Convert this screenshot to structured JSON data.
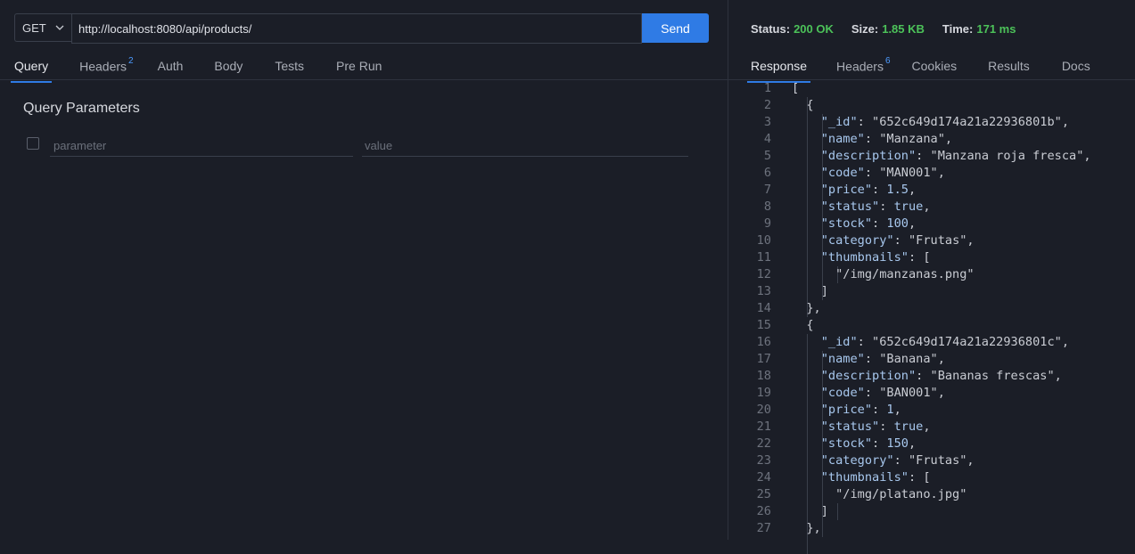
{
  "request": {
    "method": "GET",
    "url": "http://localhost:8080/api/products/",
    "send_label": "Send"
  },
  "request_tabs": [
    {
      "label": "Query",
      "badge": ""
    },
    {
      "label": "Headers",
      "badge": "2"
    },
    {
      "label": "Auth",
      "badge": ""
    },
    {
      "label": "Body",
      "badge": ""
    },
    {
      "label": "Tests",
      "badge": ""
    },
    {
      "label": "Pre Run",
      "badge": ""
    }
  ],
  "query": {
    "title": "Query Parameters",
    "param_placeholder": "parameter",
    "value_placeholder": "value"
  },
  "status": {
    "status_label": "Status:",
    "status_value": "200 OK",
    "size_label": "Size:",
    "size_value": "1.85 KB",
    "time_label": "Time:",
    "time_value": "171 ms"
  },
  "response_tabs": [
    {
      "label": "Response",
      "badge": ""
    },
    {
      "label": "Headers",
      "badge": "6"
    },
    {
      "label": "Cookies",
      "badge": ""
    },
    {
      "label": "Results",
      "badge": ""
    },
    {
      "label": "Docs",
      "badge": ""
    }
  ],
  "response_lines": [
    {
      "n": "1",
      "t": "["
    },
    {
      "n": "2",
      "t": "  {"
    },
    {
      "n": "3",
      "t": "    \"_id\": \"652c649d174a21a22936801b\","
    },
    {
      "n": "4",
      "t": "    \"name\": \"Manzana\","
    },
    {
      "n": "5",
      "t": "    \"description\": \"Manzana roja fresca\","
    },
    {
      "n": "6",
      "t": "    \"code\": \"MAN001\","
    },
    {
      "n": "7",
      "t": "    \"price\": 1.5,"
    },
    {
      "n": "8",
      "t": "    \"status\": true,"
    },
    {
      "n": "9",
      "t": "    \"stock\": 100,"
    },
    {
      "n": "10",
      "t": "    \"category\": \"Frutas\","
    },
    {
      "n": "11",
      "t": "    \"thumbnails\": ["
    },
    {
      "n": "12",
      "t": "      \"/img/manzanas.png\""
    },
    {
      "n": "13",
      "t": "    ]"
    },
    {
      "n": "14",
      "t": "  },"
    },
    {
      "n": "15",
      "t": "  {"
    },
    {
      "n": "16",
      "t": "    \"_id\": \"652c649d174a21a22936801c\","
    },
    {
      "n": "17",
      "t": "    \"name\": \"Banana\","
    },
    {
      "n": "18",
      "t": "    \"description\": \"Bananas frescas\","
    },
    {
      "n": "19",
      "t": "    \"code\": \"BAN001\","
    },
    {
      "n": "20",
      "t": "    \"price\": 1,"
    },
    {
      "n": "21",
      "t": "    \"status\": true,"
    },
    {
      "n": "22",
      "t": "    \"stock\": 150,"
    },
    {
      "n": "23",
      "t": "    \"category\": \"Frutas\","
    },
    {
      "n": "24",
      "t": "    \"thumbnails\": ["
    },
    {
      "n": "25",
      "t": "      \"/img/platano.jpg\""
    },
    {
      "n": "26",
      "t": "    ]"
    },
    {
      "n": "27",
      "t": "  },"
    }
  ]
}
